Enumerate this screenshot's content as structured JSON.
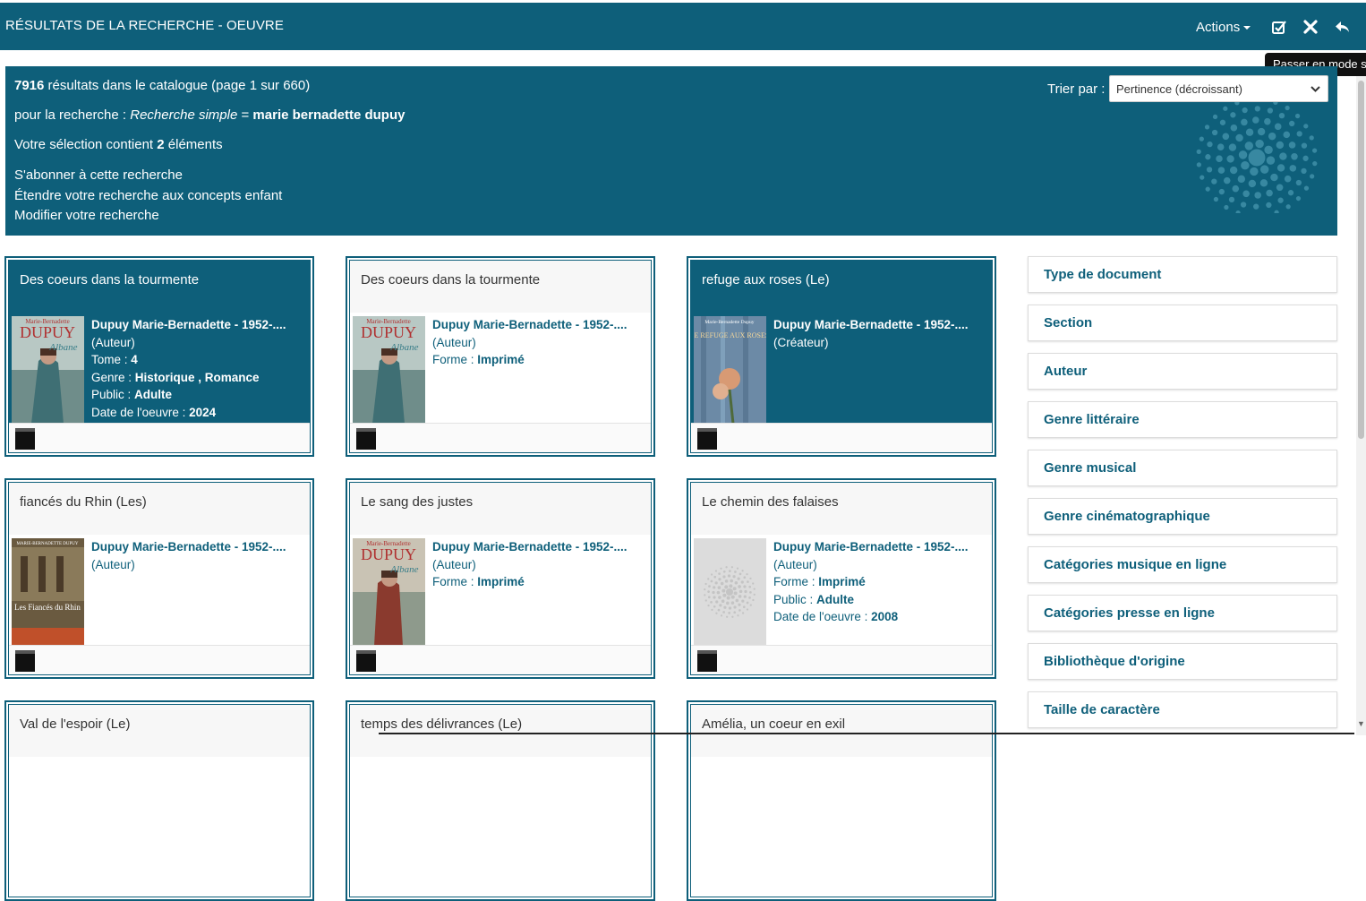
{
  "header": {
    "title": "RÉSULTATS DE LA RECHERCHE - OEUVRE",
    "actions_label": "Actions",
    "tooltip": "Passer en mode s"
  },
  "info": {
    "count": "7916",
    "count_suffix": " résultats dans le catalogue (page 1 sur 660)",
    "query_prefix": "pour la recherche : ",
    "query_type": "Recherche simple",
    "query_eq": " = ",
    "query_value": "marie bernadette dupuy",
    "selection_prefix": "Votre sélection contient ",
    "selection_count": "2",
    "selection_suffix": " éléments",
    "subscribe": "S'abonner à cette recherche",
    "extend": "Étendre votre recherche aux concepts enfant",
    "modify": "Modifier votre recherche",
    "sort_label": "Trier par :",
    "sort_value": "Pertinence (décroissant)"
  },
  "cards": [
    {
      "title": "Des coeurs dans la tourmente",
      "author": "Dupuy Marie-Bernadette - 1952-....",
      "role": "(Auteur)",
      "tome_label": "Tome : ",
      "tome": "4",
      "genre_label": "Genre : ",
      "genre": "Historique , Romance",
      "public_label": "Public : ",
      "public": "Adulte",
      "date_label": "Date de l'oeuvre : ",
      "date": "2024",
      "cover_top": "Marie-Bernadette",
      "cover_name": "DUPUY",
      "cover_script": "Albane"
    },
    {
      "title": "Des coeurs dans la tourmente",
      "author": "Dupuy Marie-Bernadette - 1952-....",
      "role": "(Auteur)",
      "forme_label": "Forme : ",
      "forme": "Imprimé",
      "cover_top": "Marie-Bernadette",
      "cover_name": "DUPUY",
      "cover_script": "Albane"
    },
    {
      "title": "refuge aux roses (Le)",
      "author": "Dupuy Marie-Bernadette - 1952-....",
      "role": "(Créateur)",
      "cover_top": "Marie-Bernadette Dupuy",
      "cover_name": "LE REFUGE AUX ROSES"
    },
    {
      "title": "fiancés du Rhin (Les)",
      "author": "Dupuy Marie-Bernadette - 1952-....",
      "role": "(Auteur)",
      "cover_top": "MARIE-BERNADETTE DUPUY",
      "cover_name": "Les Fiancés du Rhin"
    },
    {
      "title": "Le sang des justes",
      "author": "Dupuy Marie-Bernadette - 1952-....",
      "role": "(Auteur)",
      "forme_label": "Forme : ",
      "forme": "Imprimé",
      "cover_top": "Marie-Bernadette",
      "cover_name": "DUPUY",
      "cover_script": "Albane"
    },
    {
      "title": "Le chemin des falaises",
      "author": "Dupuy Marie-Bernadette - 1952-....",
      "role": "(Auteur)",
      "forme_label": "Forme : ",
      "forme": "Imprimé",
      "public_label": "Public : ",
      "public": "Adulte",
      "date_label": "Date de l'oeuvre : ",
      "date": "2008"
    },
    {
      "title": "Val de l'espoir (Le)"
    },
    {
      "title": "temps des délivrances (Le)"
    },
    {
      "title": "Amélia, un coeur en exil"
    }
  ],
  "facets": [
    "Type de document",
    "Section",
    "Auteur",
    "Genre littéraire",
    "Genre musical",
    "Genre cinématographique",
    "Catégories musique en ligne",
    "Catégories presse en ligne",
    "Bibliothèque d'origine",
    "Taille de caractère"
  ],
  "colors": {
    "primary": "#0e5f7a",
    "tooltip": "#111111"
  }
}
